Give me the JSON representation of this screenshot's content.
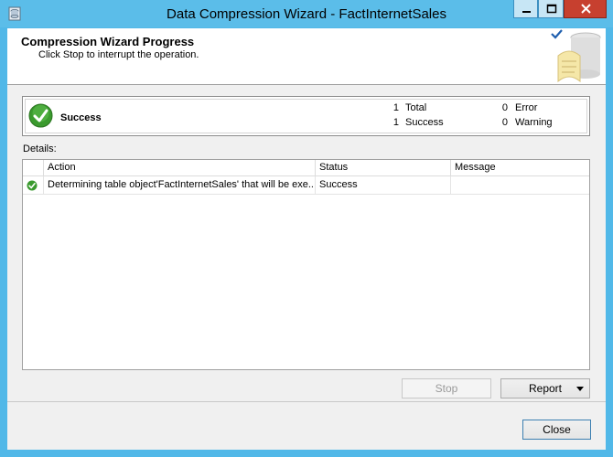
{
  "window": {
    "title": "Data Compression Wizard - FactInternetSales",
    "icon": "database-wizard-icon"
  },
  "header": {
    "title": "Compression Wizard Progress",
    "subtitle": "Click Stop to interrupt the operation."
  },
  "summary": {
    "status": "Success",
    "total_count": "1",
    "total_label": "Total",
    "success_count": "1",
    "success_label": "Success",
    "error_count": "0",
    "error_label": "Error",
    "warning_count": "0",
    "warning_label": "Warning"
  },
  "details": {
    "label": "Details:",
    "columns": [
      "Action",
      "Status",
      "Message"
    ],
    "rows": [
      {
        "icon": "success-check-icon",
        "action": "Determining table object'FactInternetSales' that will be exe...",
        "status": "Success",
        "message": ""
      }
    ]
  },
  "buttons": {
    "stop": "Stop",
    "report": "Report",
    "close": "Close"
  },
  "colors": {
    "titlebar": "#5bbde9",
    "close_button": "#c7402f",
    "success_green": "#3a9a2e"
  }
}
